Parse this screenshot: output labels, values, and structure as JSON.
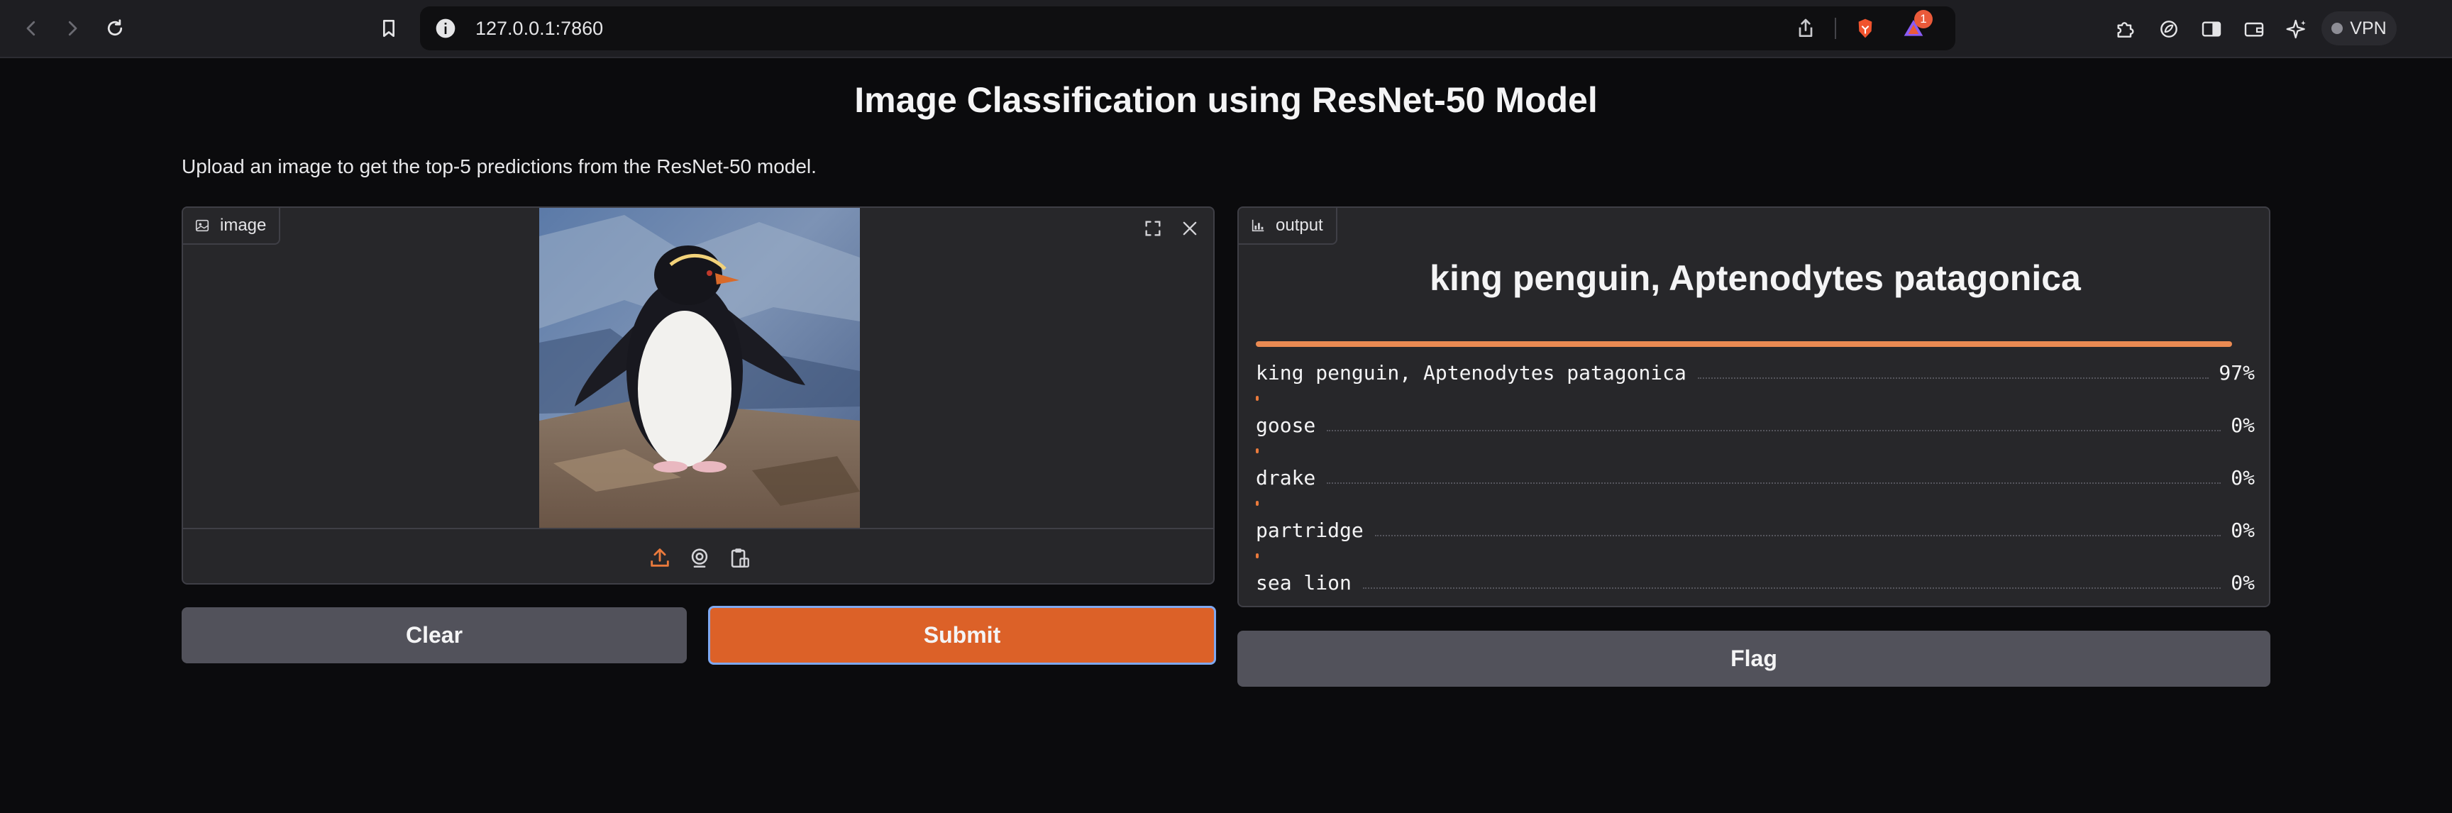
{
  "browser": {
    "url": "127.0.0.1:7860",
    "notification_count": "1",
    "vpn_label": "VPN"
  },
  "page": {
    "title": "Image Classification using ResNet-50 Model",
    "description": "Upload an image to get the top-5 predictions from the ResNet-50 model."
  },
  "image_panel": {
    "label": "image",
    "icon": "image-icon",
    "toolbar_icons": [
      "upload-icon",
      "webcam-icon",
      "clipboard-icon"
    ]
  },
  "output_panel": {
    "label": "output",
    "icon": "bar-chart-icon",
    "top_prediction": "king penguin, Aptenodytes patagonica",
    "predictions": [
      {
        "label": "king penguin, Aptenodytes patagonica",
        "percent": "97%",
        "value": 0.97
      },
      {
        "label": "goose",
        "percent": "0%",
        "value": 0.0
      },
      {
        "label": "drake",
        "percent": "0%",
        "value": 0.0
      },
      {
        "label": "partridge",
        "percent": "0%",
        "value": 0.0
      },
      {
        "label": "sea lion",
        "percent": "0%",
        "value": 0.0
      }
    ]
  },
  "buttons": {
    "clear": "Clear",
    "submit": "Submit",
    "flag": "Flag"
  },
  "colors": {
    "accent": "#dc6128",
    "background": "#0b0b0d",
    "panel": "#27272a",
    "secondary_button": "#52525b"
  }
}
